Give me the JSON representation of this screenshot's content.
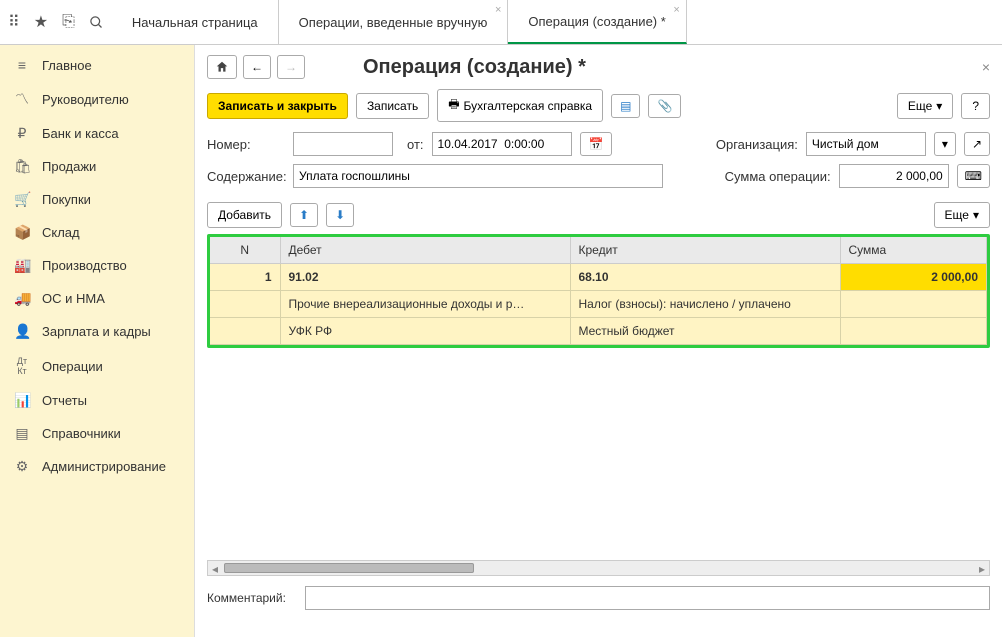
{
  "topbar": {
    "tabs": [
      {
        "label": "Начальная страница"
      },
      {
        "label": "Операции, введенные вручную"
      },
      {
        "label": "Операция (создание) *"
      }
    ]
  },
  "sidebar": {
    "items": [
      {
        "label": "Главное"
      },
      {
        "label": "Руководителю"
      },
      {
        "label": "Банк и касса"
      },
      {
        "label": "Продажи"
      },
      {
        "label": "Покупки"
      },
      {
        "label": "Склад"
      },
      {
        "label": "Производство"
      },
      {
        "label": "ОС и НМА"
      },
      {
        "label": "Зарплата и кадры"
      },
      {
        "label": "Операции"
      },
      {
        "label": "Отчеты"
      },
      {
        "label": "Справочники"
      },
      {
        "label": "Администрирование"
      }
    ]
  },
  "page": {
    "title": "Операция (создание) *",
    "toolbar": {
      "save_close": "Записать и закрыть",
      "save": "Записать",
      "report": "Бухгалтерская справка",
      "more": "Еще",
      "help": "?"
    },
    "fields": {
      "number_label": "Номер:",
      "number_value": "",
      "date_label": "от:",
      "date_value": "10.04.2017  0:00:00",
      "org_label": "Организация:",
      "org_value": "Чистый дом",
      "content_label": "Содержание:",
      "content_value": "Уплата госпошлины",
      "sum_label": "Сумма операции:",
      "sum_value": "2 000,00",
      "comment_label": "Комментарий:",
      "comment_value": ""
    },
    "table_toolbar": {
      "add": "Добавить",
      "more": "Еще"
    },
    "table": {
      "headers": {
        "n": "N",
        "debit": "Дебет",
        "credit": "Кредит",
        "amount": "Сумма"
      },
      "rows": [
        {
          "n": "1",
          "debit": "91.02",
          "credit": "68.10",
          "amount": "2 000,00",
          "debit_sub1": "Прочие внереализационные доходы и р…",
          "credit_sub1": "Налог (взносы): начислено / уплачено",
          "debit_sub2": "УФК РФ",
          "credit_sub2": "Местный бюджет"
        }
      ]
    }
  }
}
